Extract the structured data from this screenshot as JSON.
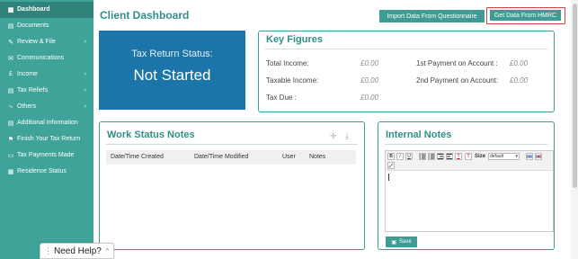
{
  "sidebar": {
    "items": [
      {
        "label": "Dashboard",
        "icon": "grid-icon",
        "glyph": "▦",
        "chevron": false
      },
      {
        "label": "Documents",
        "icon": "file-icon",
        "glyph": "▤",
        "chevron": false
      },
      {
        "label": "Review & File",
        "icon": "pencil-icon",
        "glyph": "✎",
        "chevron": true
      },
      {
        "label": "Communications",
        "icon": "envelope-icon",
        "glyph": "✉",
        "chevron": false
      },
      {
        "label": "Income",
        "icon": "pound-icon",
        "glyph": "£",
        "chevron": true
      },
      {
        "label": "Tax Reliefs",
        "icon": "document-icon",
        "glyph": "▤",
        "chevron": true
      },
      {
        "label": "Others",
        "icon": "share-icon",
        "glyph": "⤷",
        "chevron": true
      },
      {
        "label": "Additional Information",
        "icon": "list-icon",
        "glyph": "▤",
        "chevron": false
      },
      {
        "label": "Finish Your Tax Return",
        "icon": "flag-icon",
        "glyph": "⚑",
        "chevron": false
      },
      {
        "label": "Tax Payments Made",
        "icon": "wallet-icon",
        "glyph": "▭",
        "chevron": false
      },
      {
        "label": "Residence Status",
        "icon": "home-icon",
        "glyph": "▦",
        "chevron": false
      }
    ],
    "chevron_glyph": "›"
  },
  "header": {
    "title": "Client Dashboard",
    "import_button": "Import Data From Questionnaire",
    "hmrc_button": "Get Data From HMRC"
  },
  "status": {
    "label": "Tax Return Status:",
    "value": "Not Started"
  },
  "key_figures": {
    "title": "Key Figures",
    "left": [
      {
        "label": "Total Income:",
        "value": "£0.00"
      },
      {
        "label": "Taxable Income:",
        "value": "£0.00"
      },
      {
        "label": "Tax Due :",
        "value": "£0.00"
      }
    ],
    "right": [
      {
        "label": "1st Payment on Account :",
        "value": "£0.00"
      },
      {
        "label": "2nd Payment on Account:",
        "value": "£0.00"
      }
    ]
  },
  "work_status": {
    "title": "Work Status Notes",
    "add_glyph": "✛",
    "download_glyph": "⤓",
    "columns": [
      "Date/Time Created",
      "Date/Time Modified",
      "User",
      "Notes"
    ]
  },
  "internal_notes": {
    "title": "Internal Notes",
    "toolbar": {
      "bold": "B",
      "italic": "I",
      "underline": "U",
      "size_label": "Size",
      "size_value": "default"
    },
    "save_label": "Save",
    "save_glyph": "▣"
  },
  "help": {
    "label": "Need Help?",
    "dots": "⋮",
    "chevron": "^"
  }
}
